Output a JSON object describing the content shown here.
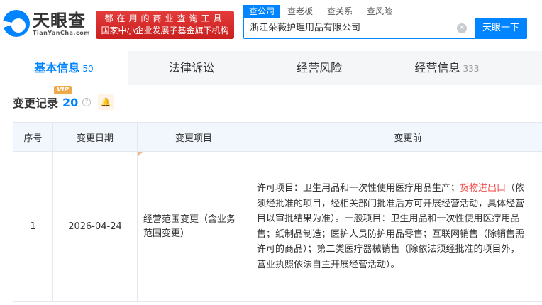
{
  "logo": {
    "cn": "天眼查",
    "en": "TianYanCha.com"
  },
  "slogan": {
    "line1": "都在用的商业查询工具",
    "line2": "国家中小企业发展子基金旗下机构"
  },
  "search": {
    "tabs": [
      "查公司",
      "查老板",
      "查关系",
      "查风险"
    ],
    "value": "浙江朵薇护理用品有限公司",
    "button": "天眼一下"
  },
  "tabs": [
    {
      "label": "基本信息",
      "count": "50"
    },
    {
      "label": "法律诉讼"
    },
    {
      "label": "经营风险"
    },
    {
      "label": "经营信息",
      "count": "333"
    }
  ],
  "section": {
    "title": "变更记录",
    "count": "20",
    "badge": "VIP"
  },
  "table": {
    "headers": [
      "序号",
      "变更日期",
      "变更项目",
      "变更前"
    ],
    "rows": [
      {
        "index": "1",
        "date": "2026-04-24",
        "item": "经营范围变更（含业务范围变更）",
        "before": {
          "line1_a": "许可项目：卫生用品和一次性使用医疗用品生产；",
          "line1_red": "货物进出口",
          "line1_b": "（依",
          "lines": [
            "须经批准的项目，经相关部门批准后方可开展经营活动，具体经营",
            "目以审批结果为准）。一般项目：卫生用品和一次性使用医疗用品",
            "售；纸制品制造；医护人员防护用品零售；互联网销售（除销售需",
            "许可的商品）；第二类医疗器械销售（除依法须经批准的项目外，",
            "营业执照依法自主开展经营活动）。"
          ]
        }
      }
    ]
  }
}
